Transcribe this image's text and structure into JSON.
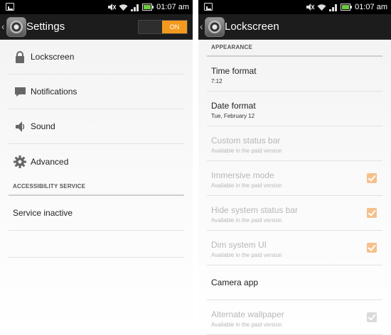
{
  "status_bar": {
    "time": "01:07 am"
  },
  "left": {
    "title": "Settings",
    "toggle_label": "ON",
    "items": [
      {
        "label": "Lockscreen",
        "icon": "lock-icon"
      },
      {
        "label": "Notifications",
        "icon": "speech-bubble-icon"
      },
      {
        "label": "Sound",
        "icon": "speaker-icon"
      },
      {
        "label": "Advanced",
        "icon": "gear-icon"
      }
    ],
    "section_accessibility": "ACCESSIBILITY SERVICE",
    "service_status": "Service inactive"
  },
  "right": {
    "title": "Lockscreen",
    "section_appearance": "APPEARANCE",
    "prefs": [
      {
        "title": "Time format",
        "subtitle": "7:12",
        "enabled": true,
        "checkbox": null
      },
      {
        "title": "Date format",
        "subtitle": "Tue, February 12",
        "enabled": true,
        "checkbox": null
      },
      {
        "title": "Custom status bar",
        "subtitle": "Available in the paid version",
        "enabled": false,
        "checkbox": null
      },
      {
        "title": "Immersive mode",
        "subtitle": "Available in the paid version",
        "enabled": false,
        "checkbox": "checked"
      },
      {
        "title": "Hide system status bar",
        "subtitle": "Available in the paid version",
        "enabled": false,
        "checkbox": "checked"
      },
      {
        "title": "Dim system UI",
        "subtitle": "Available in the paid version",
        "enabled": false,
        "checkbox": "checked"
      },
      {
        "title": "Camera app",
        "subtitle": "",
        "enabled": true,
        "checkbox": null
      },
      {
        "title": "Alternate wallpaper",
        "subtitle": "Available in the paid version",
        "enabled": false,
        "checkbox": "checked-grey"
      }
    ]
  },
  "colors": {
    "accent": "#f39a1e",
    "checkbox_disabled": "#f6c08a",
    "actionbar": "#1c1c1c"
  }
}
